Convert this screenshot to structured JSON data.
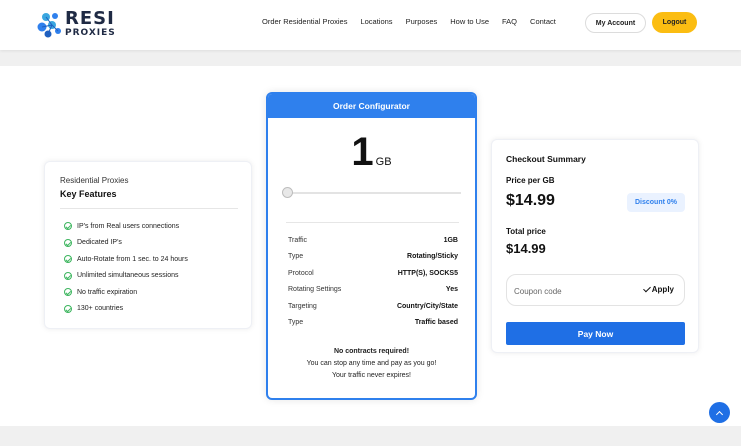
{
  "brand": {
    "logo_line1": "RESI",
    "logo_line2": "PROXIES"
  },
  "nav": {
    "items": [
      "Order Residential Proxies",
      "Locations",
      "Purposes",
      "How to Use",
      "FAQ",
      "Contact"
    ],
    "my_account": "My Account",
    "logout": "Logout"
  },
  "features": {
    "subtitle": "Residential Proxies",
    "title": "Key Features",
    "items": [
      "IP's from Real users connections",
      "Dedicated IP's",
      "Auto-Rotate from 1 sec. to 24 hours",
      "Unlimited simultaneous sessions",
      "No traffic expiration",
      "130+ countries"
    ]
  },
  "configurator": {
    "title": "Order Configurator",
    "amount": "1",
    "unit": "GB",
    "slider_value": 1,
    "specs": [
      {
        "label": "Traffic",
        "value": "1GB"
      },
      {
        "label": "Type",
        "value": "Rotating/Sticky"
      },
      {
        "label": "Protocol",
        "value": "HTTP(S), SOCKS5"
      },
      {
        "label": "Rotating Settings",
        "value": "Yes"
      },
      {
        "label": "Targeting",
        "value": "Country/City/State"
      },
      {
        "label": "Type",
        "value": "Traffic based"
      }
    ],
    "note_bold": "No contracts required!",
    "note_line2": "You can stop any time and pay as you go!",
    "note_line3": "Your traffic never expires!"
  },
  "checkout": {
    "title": "Checkout Summary",
    "price_label": "Price per GB",
    "price": "$14.99",
    "discount": "Discount 0%",
    "total_label": "Total price",
    "total": "$14.99",
    "coupon_placeholder": "Coupon code",
    "apply": "Apply",
    "pay": "Pay Now"
  },
  "colors": {
    "accent_blue": "#2f80ed",
    "logout_yellow": "#fbbd12",
    "check_green": "#3cb55e"
  },
  "icons": {
    "logo": "globe-network-logo",
    "scroll_top": "chevron-up-icon"
  }
}
